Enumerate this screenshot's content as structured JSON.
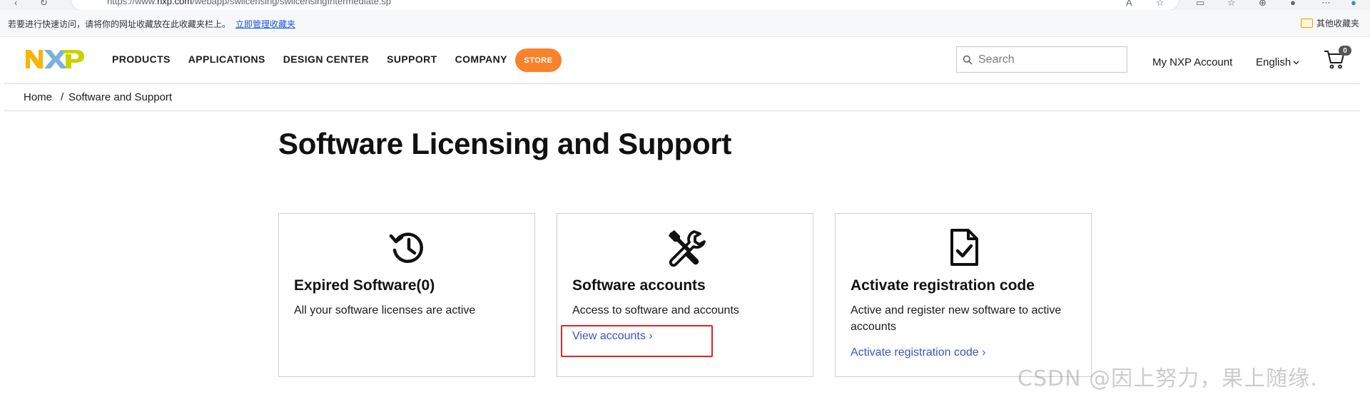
{
  "browser": {
    "url_prefix": "https://www.",
    "url_domain": "nxp.com",
    "url_path": "/webapp/swlicensing/swlicensingIntermediate.sp",
    "bookmark_hint": "若要进行快速访问，请将你的网址收藏放在此收藏夹栏上。",
    "bookmark_manage_link": "立即管理收藏夹",
    "other_bookmarks": "其他收藏夹"
  },
  "header": {
    "nav": [
      "PRODUCTS",
      "APPLICATIONS",
      "DESIGN CENTER",
      "SUPPORT",
      "COMPANY"
    ],
    "store_label": "STORE",
    "search_placeholder": "Search",
    "account_label": "My NXP Account",
    "language": "English",
    "cart_count": "0",
    "colors": {
      "accent": "#f9822a",
      "logo_orange": "#f9b500",
      "logo_blue": "#7bb1db",
      "logo_green": "#c9d200",
      "link": "#3c53c7"
    }
  },
  "breadcrumb": {
    "home": "Home",
    "separator": "/",
    "current": "Software and Support"
  },
  "page": {
    "title": "Software Licensing and Support"
  },
  "cards": [
    {
      "icon": "history-icon",
      "title": "Expired Software(0)",
      "description": "All your software licenses are active",
      "link": ""
    },
    {
      "icon": "tools-icon",
      "title": "Software accounts",
      "description": "Access to software and accounts",
      "link": "View accounts ›"
    },
    {
      "icon": "file-check-icon",
      "title": "Activate registration code",
      "description": "Active and register new software to active accounts",
      "link": "Activate registration code ›"
    }
  ],
  "watermark": "CSDN @因上努力，果上随缘."
}
